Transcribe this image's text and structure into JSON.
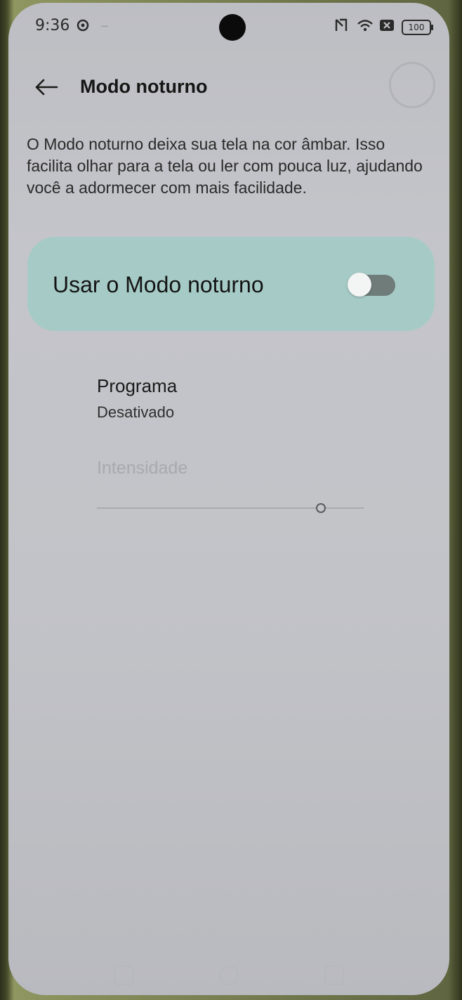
{
  "status_bar": {
    "time": "9:36",
    "battery": "100",
    "icons": [
      "settings-gear-icon",
      "nfc-icon",
      "wifi-icon",
      "sim-icon",
      "battery-icon"
    ]
  },
  "header": {
    "title": "Modo noturno",
    "back_icon": "arrow-left-icon"
  },
  "description": "O Modo noturno deixa sua tela na cor âmbar. Isso facilita olhar para a tela ou ler com pouca luz, ajudando você a adormecer com mais facilidade.",
  "toggle": {
    "label": "Usar o Modo noturno",
    "checked": false
  },
  "schedule": {
    "title": "Programa",
    "value": "Desativado"
  },
  "intensity": {
    "label": "Intensidade",
    "value": 0.84,
    "enabled": false
  },
  "colors": {
    "toggle_card": "#a6cbc6",
    "background": "#c2c3c8"
  }
}
